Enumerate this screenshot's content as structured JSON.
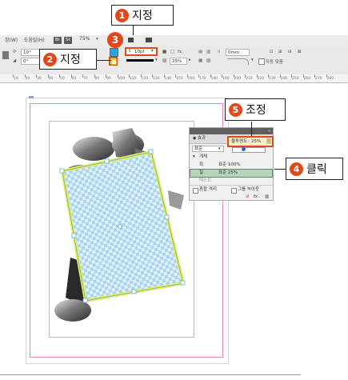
{
  "callouts": [
    {
      "num": "1",
      "text": "지정"
    },
    {
      "num": "2",
      "text": "지정"
    },
    {
      "num": "3",
      "text": ""
    },
    {
      "num": "4",
      "text": "클릭"
    },
    {
      "num": "5",
      "text": "조정"
    }
  ],
  "menubar": {
    "items": [
      "창(W)",
      "도움말(H)",
      "Br",
      "St",
      "75%"
    ]
  },
  "control_bar": {
    "size1": "10°",
    "size2": "0°",
    "stroke_weight": "10pt",
    "opacity": "25%",
    "dimension": "0mm",
    "auto_fit_label": "자동 맞춤",
    "fx_label": "fx."
  },
  "ruler": {
    "ticks": [
      "10",
      "20",
      "30",
      "40",
      "50",
      "60",
      "70",
      "80",
      "90",
      "100",
      "110",
      "120",
      "130",
      "140",
      "150",
      "160",
      "170",
      "180",
      "190",
      "200",
      "210",
      "220",
      "230",
      "240",
      "250",
      "260",
      "270",
      "280"
    ]
  },
  "effects_panel": {
    "title": "효과",
    "blend_mode": "표준",
    "opacity_label": "불투명도:",
    "opacity_value": "25%",
    "rows": [
      {
        "name": "개체",
        "value": ""
      },
      {
        "name": "획",
        "value": "표준 100%"
      },
      {
        "name": "칠",
        "value": "표준 25%"
      },
      {
        "name": "텍스트",
        "value": ""
      }
    ],
    "isolate_label": "혼합 격리",
    "knockout_label": "그룹 녹아웃",
    "fx_label": "fx."
  },
  "colors": {
    "accent": "#e1491b",
    "selected_row": "#b9d3bf",
    "frame_stroke": "#e6ee55",
    "highlight_border": "#e1491b"
  }
}
